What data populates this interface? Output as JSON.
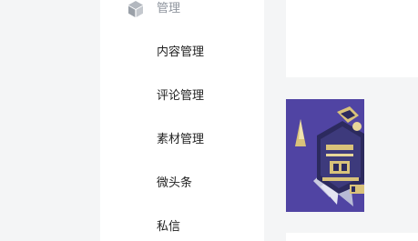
{
  "sidebar": {
    "group": {
      "label": "管理",
      "icon": "cube-icon"
    },
    "items": [
      {
        "label": "内容管理"
      },
      {
        "label": "评论管理"
      },
      {
        "label": "素材管理"
      },
      {
        "label": "微头条"
      },
      {
        "label": "私信"
      }
    ]
  },
  "colors": {
    "background": "#f4f5f6",
    "sidebar_bg": "#ffffff",
    "group_label": "#8f959e",
    "item_text": "#222222",
    "artwork_bg": "#5448a8",
    "artwork_accent": "#d9c27a"
  }
}
